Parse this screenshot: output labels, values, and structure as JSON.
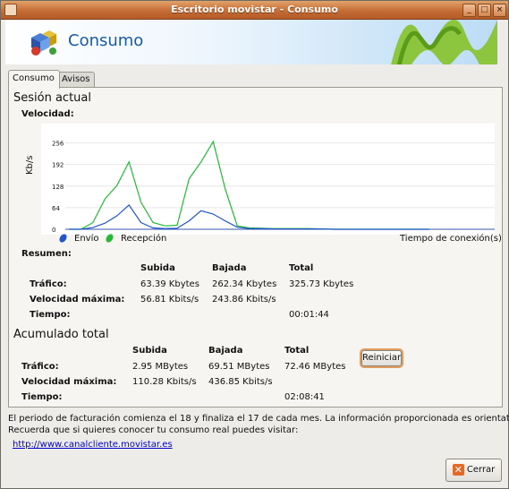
{
  "window": {
    "title": "Escritorio movistar - Consumo"
  },
  "banner": {
    "title": "Consumo"
  },
  "tabs": [
    {
      "label": "Consumo"
    },
    {
      "label": "Avisos"
    }
  ],
  "session": {
    "heading": "Sesión actual",
    "speed_label": "Velocidad:",
    "summary_label": "Resumen:",
    "columns": [
      "Subida",
      "Bajada",
      "Total"
    ],
    "rows": [
      {
        "label": "Tráfico:",
        "subida": "63.39 Kbytes",
        "bajada": "262.34 Kbytes",
        "total": "325.73 Kbytes"
      },
      {
        "label": "Velocidad máxima:",
        "subida": "56.81 Kbits/s",
        "bajada": "243.86 Kbits/s",
        "total": ""
      },
      {
        "label": "Tiempo:",
        "subida": "",
        "bajada": "",
        "total": "00:01:44"
      }
    ]
  },
  "accumulated": {
    "heading": "Acumulado total",
    "columns": [
      "Subida",
      "Bajada",
      "Total"
    ],
    "rows": [
      {
        "label": "Tráfico:",
        "subida": "2.95 MBytes",
        "bajada": "69.51 MBytes",
        "total": "72.46 MBytes"
      },
      {
        "label": "Velocidad máxima:",
        "subida": "110.28 Kbits/s",
        "bajada": "436.85 Kbits/s",
        "total": ""
      },
      {
        "label": "Tiempo:",
        "subida": "",
        "bajada": "",
        "total": "02:08:41"
      }
    ],
    "reset_button": "Reiniciar"
  },
  "footer": {
    "info_line1": "El periodo de facturación comienza el 18 y finaliza el 17 de cada mes. La información proporcionada es orientativa.",
    "info_line2": "Recuerda que si quieres conocer tu consumo real puedes visitar:",
    "link": "http://www.canalcliente.movistar.es",
    "close_button": "Cerrar"
  },
  "chart_data": {
    "type": "line",
    "ylabel": "Kb/s",
    "xlabel": "Tiempo de conexión(s)",
    "yticks": [
      0,
      64,
      128,
      192,
      256
    ],
    "ylim": [
      0,
      300
    ],
    "x": [
      0,
      1,
      2,
      3,
      4,
      5,
      6,
      7,
      8,
      9,
      10,
      11,
      12,
      13,
      14,
      15,
      16,
      17,
      18,
      19,
      20,
      21,
      22,
      23,
      24,
      25,
      26,
      27,
      28,
      29,
      30
    ],
    "series": [
      {
        "name": "Envío",
        "color": "#2255cc",
        "values": [
          0,
          0,
          5,
          18,
          40,
          72,
          20,
          4,
          2,
          3,
          25,
          55,
          45,
          25,
          6,
          2,
          2,
          1,
          1,
          1,
          1,
          1,
          0,
          0,
          0,
          0,
          0,
          0,
          0,
          0,
          0
        ]
      },
      {
        "name": "Recepción",
        "color": "#22bb33",
        "values": [
          0,
          0,
          20,
          90,
          130,
          200,
          80,
          20,
          10,
          12,
          150,
          200,
          260,
          120,
          10,
          4,
          3,
          2,
          2,
          2,
          2,
          1,
          0,
          0,
          0,
          0,
          0,
          0,
          0,
          0,
          0
        ]
      }
    ],
    "grid": true,
    "legend": "bottom-left"
  },
  "colors": {
    "titlebar": "#c56d35",
    "accent": "#1a5aa6",
    "envio": "#2255cc",
    "recepcion": "#22bb33"
  }
}
